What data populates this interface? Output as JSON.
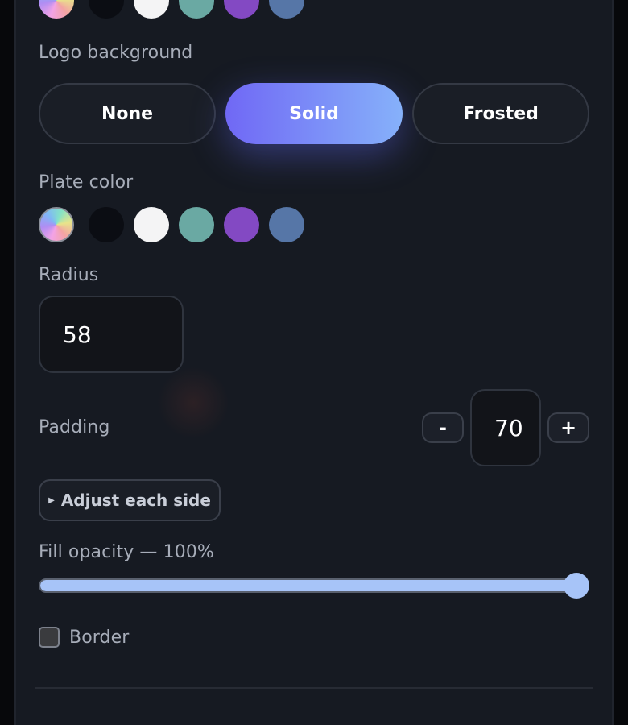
{
  "colors": {
    "panel": "#161a22",
    "accent_start": "#7068f5",
    "accent_end": "#86b1fa",
    "slider": "#a7c4f8"
  },
  "swatch_palette": [
    {
      "name": "rainbow",
      "color": "conic-gradient(from 200deg, #f3a3e6, #b08df3, #7fb7f5, #84e3c7, #e8e48a, #f3a3a3, #f3a3e6)"
    },
    {
      "name": "black",
      "color": "#0b0d13"
    },
    {
      "name": "white",
      "color": "#f4f4f5"
    },
    {
      "name": "teal",
      "color": "#6aa9a3"
    },
    {
      "name": "purple",
      "color": "#8349c3"
    },
    {
      "name": "slate-blue",
      "color": "#5676a7"
    }
  ],
  "logo_background": {
    "label": "Logo background",
    "options": [
      "None",
      "Solid",
      "Frosted"
    ],
    "selected": "Solid"
  },
  "plate_color": {
    "label": "Plate color"
  },
  "radius": {
    "label": "Radius",
    "value": "58"
  },
  "padding": {
    "label": "Padding",
    "value": "70",
    "decrement": "-",
    "increment": "+"
  },
  "adjust_sides": {
    "label": "Adjust each side",
    "icon": "triangle-right-icon"
  },
  "fill_opacity": {
    "label": "Fill opacity — 100%",
    "percent": 100
  },
  "border": {
    "label": "Border",
    "checked": false
  }
}
